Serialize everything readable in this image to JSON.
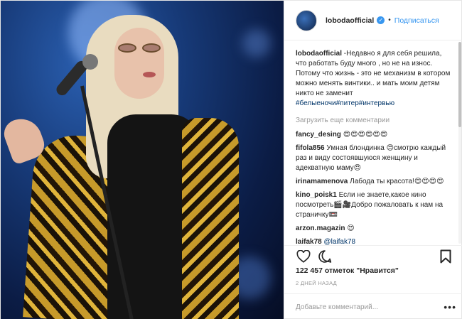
{
  "post": {
    "username": "lobodaofficial",
    "follow_label": "Подписаться",
    "separator": "•",
    "caption_user": "lobodaofficial",
    "caption_text": " -Недавно я для себя решила, что работать буду много , но не на износ. Потому что жизнь - это не механизм в котором можно менять винтики.. и мать моим детям никто не заменит ",
    "caption_tags": "#белыеночи#питер#интервью",
    "load_more": "Загрузить еще комментарии",
    "likes": "122 457 отметок \"Нравится\"",
    "time": "2 ДНЕЙ НАЗАД",
    "comment_placeholder": "Добавьте комментарий...",
    "more_label": "•••"
  },
  "comments": [
    {
      "user": "fancy_desing",
      "text": " 😍😍😍😍😍😍"
    },
    {
      "user": "fifola856",
      "text": " Умная блондинка 😍смотрю каждый раз и виду состоявшуюся женщину и адекватную маму😍"
    },
    {
      "user": "irinamamenova",
      "text": " Лабода ты красота!😍😍😍😍"
    },
    {
      "user": "kino_poisk1",
      "text": " Если не знаете,какое кино посмотреть🎬🎥Добро пожаловать к нам на страничку📼"
    },
    {
      "user": "arzon.magazin",
      "text": " 😍"
    },
    {
      "user": "laifak78",
      "text": " ",
      "mention": "@laifak78"
    }
  ],
  "colors": {
    "accent": "#3897f0",
    "text": "#262626",
    "muted": "#999999",
    "hashtag": "#003569",
    "border": "#efefef"
  },
  "icons": {
    "like": "heart-outline-icon",
    "comment": "speech-bubble-icon",
    "save": "bookmark-icon",
    "verified": "verified-badge-icon"
  }
}
